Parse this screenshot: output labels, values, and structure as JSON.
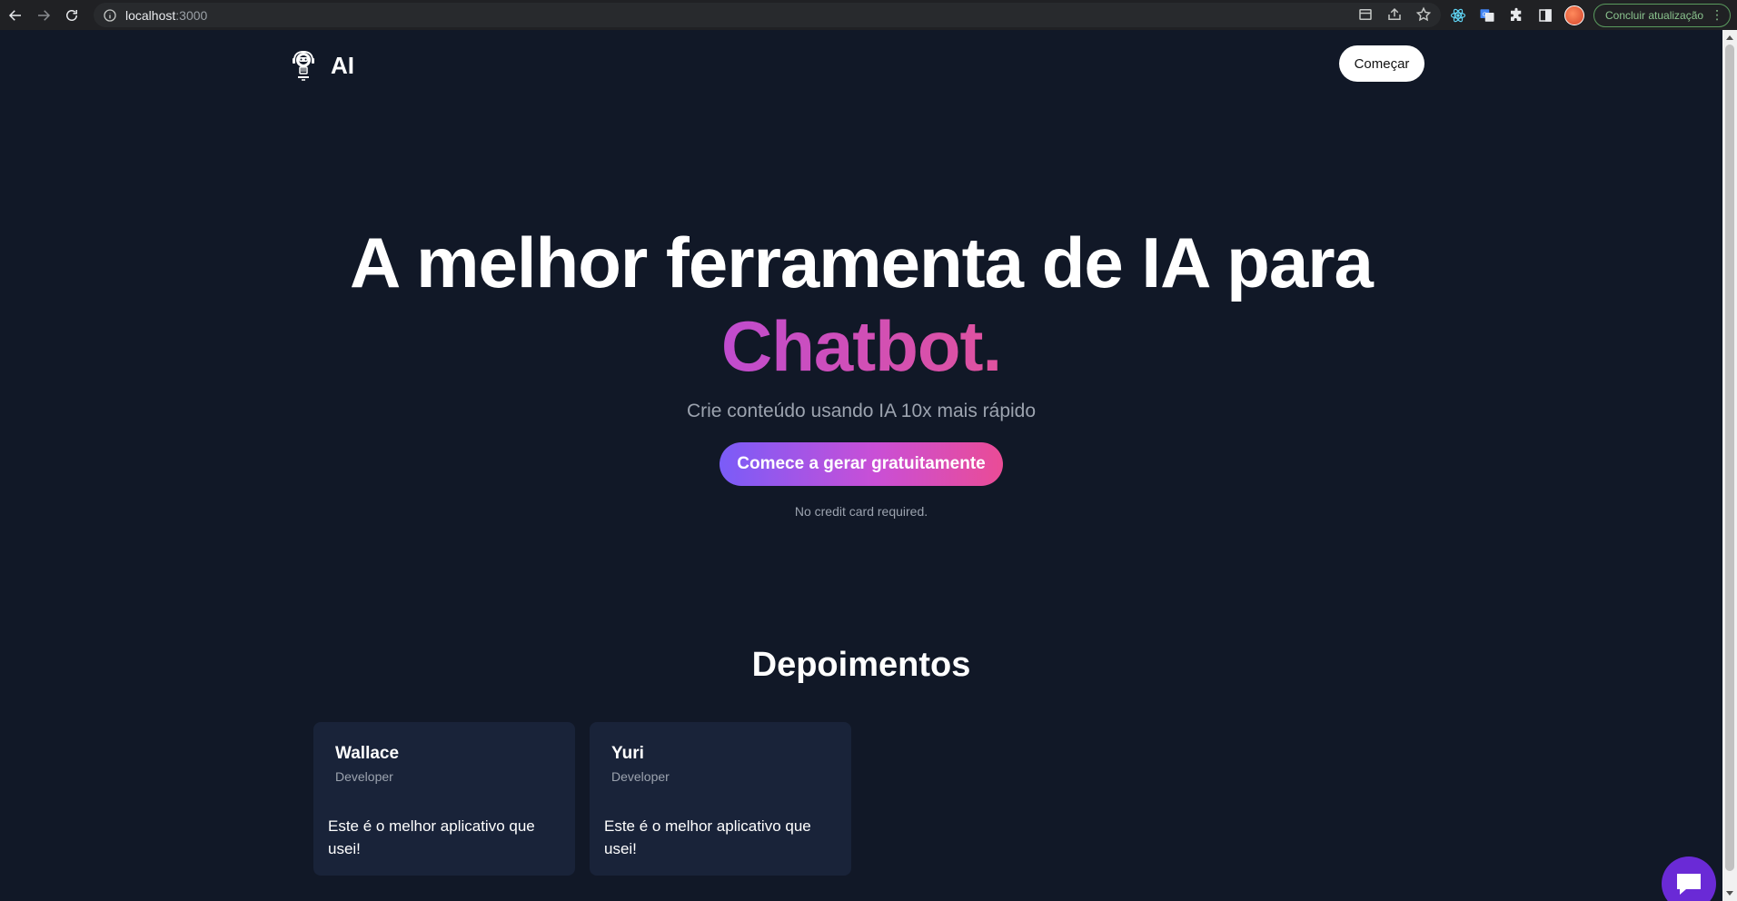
{
  "browser": {
    "url_host": "localhost",
    "url_port": ":3000",
    "update_label": "Concluir atualização"
  },
  "navbar": {
    "brand": "AI",
    "cta_label": "Começar"
  },
  "hero": {
    "title_line1": "A melhor ferramenta de IA para",
    "title_line2": "Chatbot.",
    "subtitle": "Crie conteúdo usando IA 10x mais rápido",
    "cta_label": "Comece a gerar gratuitamente",
    "note": "No credit card required."
  },
  "testimonials": {
    "title": "Depoimentos",
    "items": [
      {
        "name": "Wallace",
        "role": "Developer",
        "text": "Este é o melhor aplicativo que usei!"
      },
      {
        "name": "Yuri",
        "role": "Developer",
        "text": "Este é o melhor aplicativo que usei!"
      }
    ]
  },
  "icons": {
    "back": "arrow-left-icon",
    "forward": "arrow-right-icon",
    "reload": "reload-icon",
    "info": "info-icon",
    "logo": "robot-logo-icon",
    "chat": "chat-bubble-icon"
  },
  "colors": {
    "page_bg": "#111827",
    "card_bg": "#192339",
    "accent_purple": "#7a5cf8",
    "accent_pink": "#ea4c96",
    "chat_fab": "#6a2ad6"
  }
}
